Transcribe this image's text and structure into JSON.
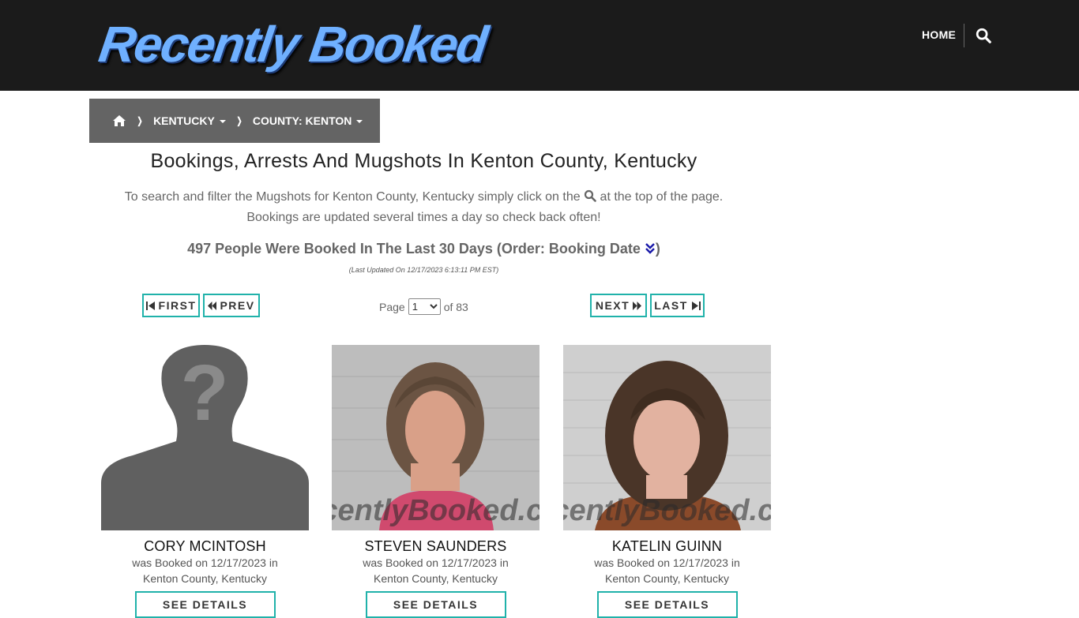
{
  "header": {
    "logo_text": "Recently Booked",
    "nav_home": "HOME",
    "search_icon": "search-icon"
  },
  "breadcrumb": {
    "home_icon": "home-icon",
    "state": "KENTUCKY",
    "county": "COUNTY: KENTON"
  },
  "page": {
    "title": "Bookings, Arrests And Mugshots In Kenton County, Kentucky",
    "intro_part1": "To search and filter the Mugshots for Kenton County, Kentucky simply click on the",
    "intro_part2": "at the top of the page.",
    "intro_line2": "Bookings are updated several times a day so check back often!",
    "count_text": "497 People Were Booked In The Last 30 Days (Order: Booking Date",
    "count_close": ")",
    "last_updated": "(Last Updated On 12/17/2023 6:13:11 PM EST)"
  },
  "pagination": {
    "first": "FIRST",
    "prev": "PREV",
    "page_label": "Page",
    "current_page": "1",
    "of_label": "of 83",
    "next": "NEXT",
    "last": "LAST"
  },
  "bookings": [
    {
      "name": "CORY MCINTOSH",
      "line1": "was Booked on 12/17/2023 in",
      "line2": "Kenton County, Kentucky",
      "button": "SEE DETAILS",
      "photo": "placeholder-silhouette"
    },
    {
      "name": "STEVEN SAUNDERS",
      "line1": "was Booked on 12/17/2023 in",
      "line2": "Kenton County, Kentucky",
      "button": "SEE DETAILS",
      "photo": "mugshot",
      "watermark": "RecentlyBooked.com"
    },
    {
      "name": "KATELIN GUINN",
      "line1": "was Booked on 12/17/2023 in",
      "line2": "Kenton County, Kentucky",
      "button": "SEE DETAILS",
      "photo": "mugshot",
      "watermark": "RecentlyBooked.com"
    }
  ],
  "colors": {
    "header_bg": "#1b1b1b",
    "breadcrumb_bg": "#646464",
    "accent_teal": "#20b2aa",
    "logo_blue": "#6fb0ff"
  }
}
